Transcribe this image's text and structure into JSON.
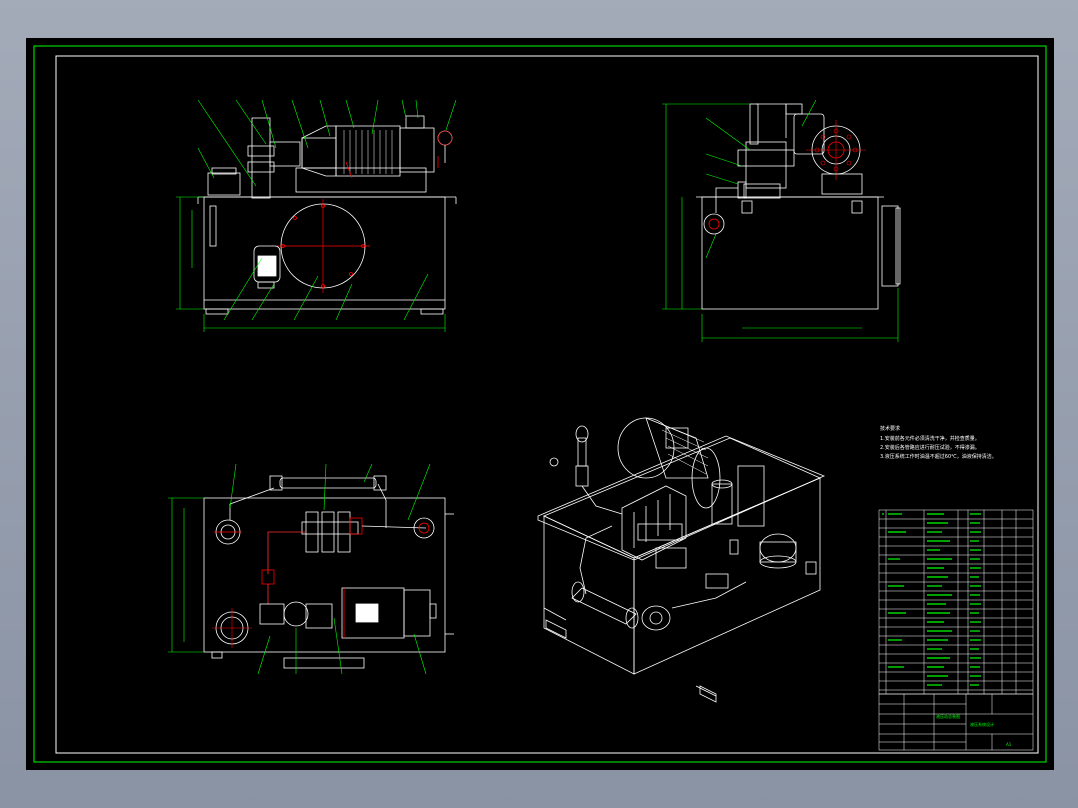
{
  "colors": {
    "background": "#000000",
    "frame": "#00ff00",
    "outline": "#ffffff",
    "centerline": "#ff0000",
    "dimension": "#00ff00",
    "pipe": "#ff3030",
    "notes": "#ffffff"
  },
  "notes": {
    "title": "技术要求",
    "lines": [
      "1.安装前各元件必须清洗干净，并检查质量。",
      "2.安装后各管路应进行耐压试验，不得渗漏。",
      "3.液压系统工作时油温不超过60℃，油液保持清洁。"
    ]
  },
  "title_block": {
    "drawing_name": "液压站总装图",
    "company": "液压系统设计",
    "sheet_label": "A1"
  }
}
